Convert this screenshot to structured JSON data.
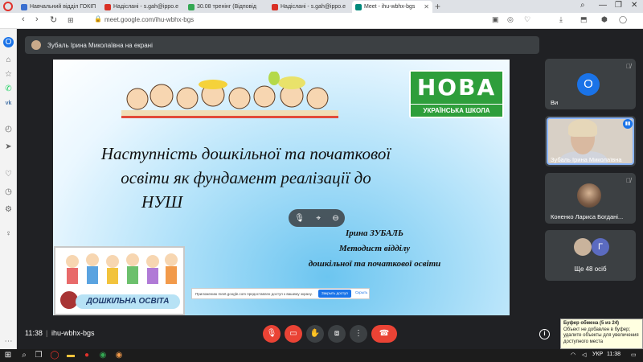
{
  "browser": {
    "tabs": [
      {
        "label": "Навчальний відділ ГОКІП",
        "color": "#3b6fd0"
      },
      {
        "label": "Надіслані - s.gah@ippo.e",
        "color": "#d93025"
      },
      {
        "label": "30.08 тренінг (Відповід",
        "color": "#34a853"
      },
      {
        "label": "Надіслані - s.gah@ippo.e",
        "color": "#d93025"
      },
      {
        "label": "Meet - ihu-wbhx-bgs",
        "color": "#00897b"
      }
    ],
    "url": "meet.google.com/ihu-wbhx-bgs"
  },
  "meet": {
    "presenter_banner": "Зубаль Ірина Миколаївна на екрані",
    "time": "11:38",
    "separator": "|",
    "meeting_code": "ihu-wbhx-bgs"
  },
  "slide": {
    "logo_nova": "НОВА",
    "logo_school": "УКРАЇНСЬКА ШКОЛА",
    "title_line1": "Наступність дошкільної та початкової",
    "title_line2": "освіти як фундамент реалізації до",
    "title_line3": "НУШ",
    "author_name": "Ірина ЗУБАЛЬ",
    "author_role1": "Методист відділу",
    "author_role2": "дошкільної та початкової освіти",
    "preschool_label": "ДОШКІЛЬНА ОСВІТА"
  },
  "share_bar": {
    "text": "Приложению meet.google.com предоставлен доступ к вашему экрану.",
    "stop": "Закрыть доступ",
    "hide": "Скрыть"
  },
  "participants": [
    {
      "name": "Ви",
      "initial": "О"
    },
    {
      "name": "Зубаль Ірина Миколаївна"
    },
    {
      "name": "Коненко Лариса Богдані..."
    },
    {
      "more_label": "Ще 48 осіб",
      "initial": "Г"
    }
  ],
  "clipboard": {
    "title": "Буфер обмена (5 из 24)",
    "message": "Объект не добавлен в буфер; удалите объекты для увеличения доступного места"
  },
  "taskbar": {
    "lang": "УКР",
    "clock": "11:38"
  },
  "colors": {
    "accent": "#1a73e8",
    "hangup": "#ea4335",
    "nus_green": "#2e9e3b"
  }
}
